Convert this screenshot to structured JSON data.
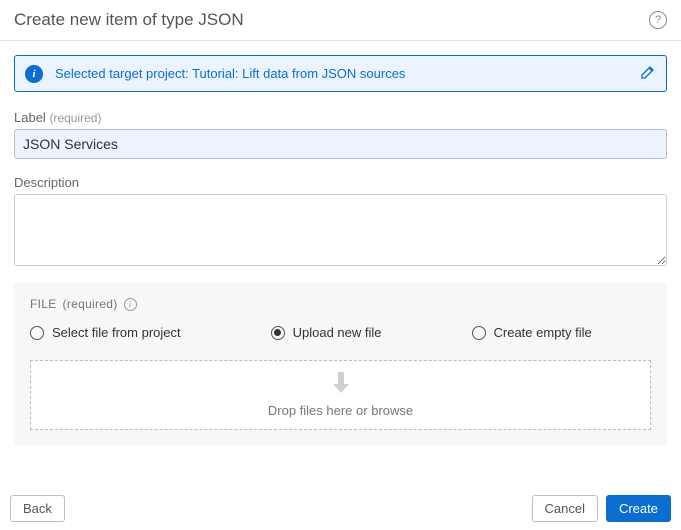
{
  "header": {
    "title": "Create new item of type JSON"
  },
  "banner": {
    "text": "Selected target project: Tutorial: Lift data from JSON sources"
  },
  "fields": {
    "label_label": "Label",
    "label_required": "(required)",
    "label_value": "JSON Services",
    "description_label": "Description",
    "description_value": ""
  },
  "file_section": {
    "title": "FILE",
    "required": "(required)",
    "options": {
      "from_project": "Select file from project",
      "upload_new": "Upload new file",
      "create_empty": "Create empty file"
    },
    "selected": "upload_new",
    "dropzone_text": "Drop files here or browse"
  },
  "footer": {
    "back": "Back",
    "cancel": "Cancel",
    "create": "Create"
  }
}
